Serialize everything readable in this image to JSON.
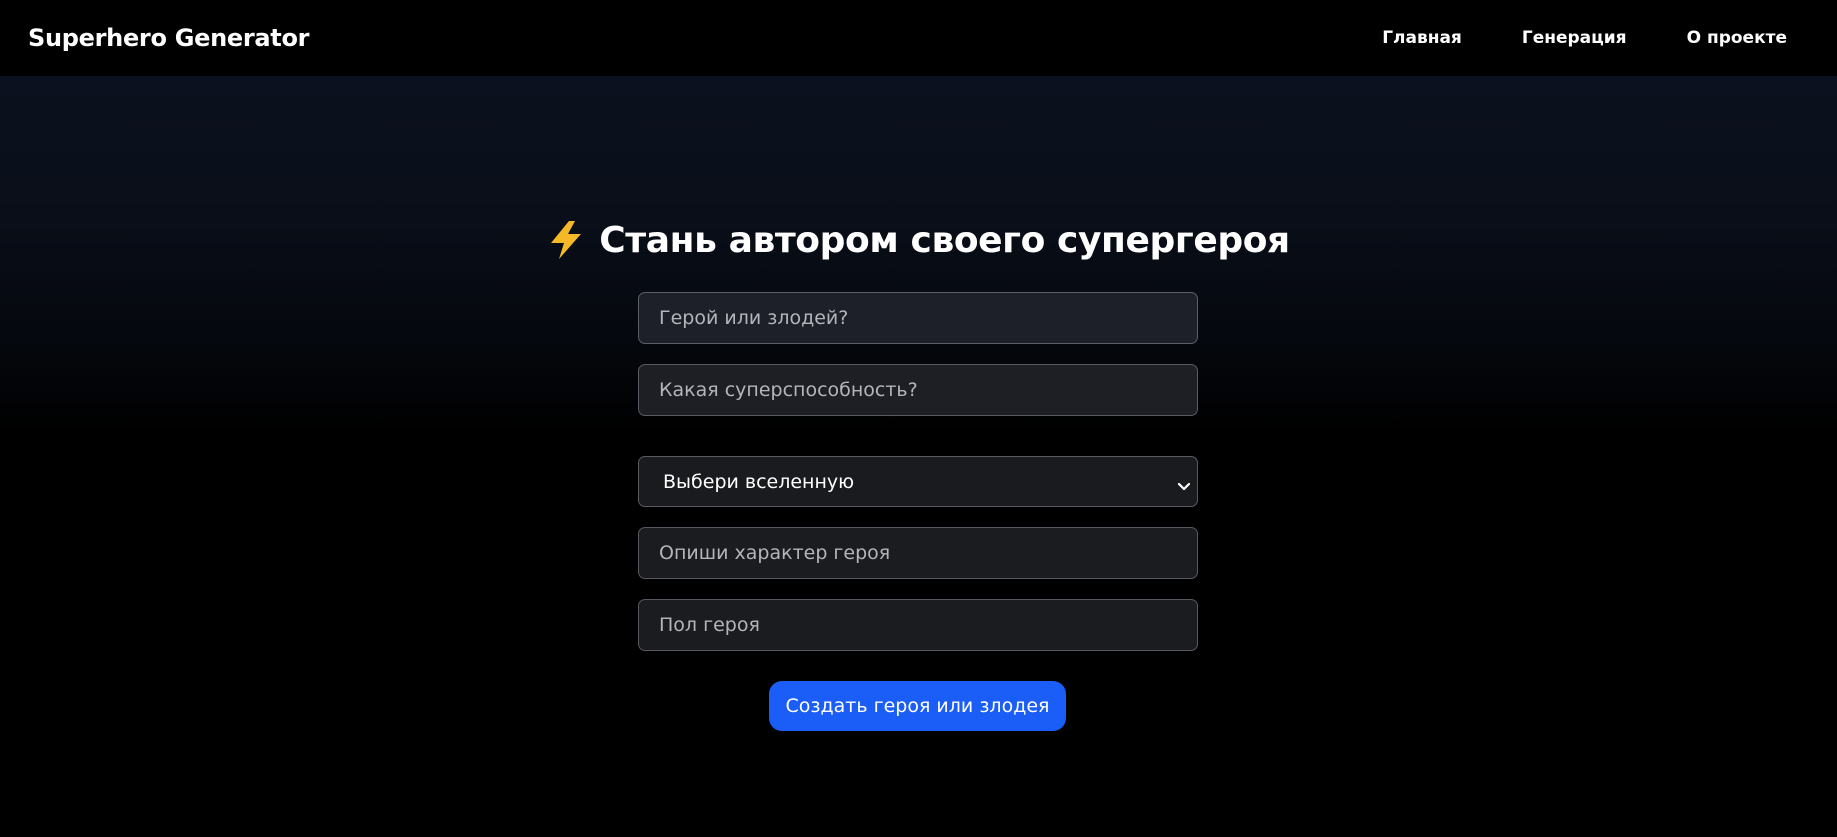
{
  "navbar": {
    "brand": "Superhero Generator",
    "links": [
      {
        "label": "Главная"
      },
      {
        "label": "Генерация"
      },
      {
        "label": "О проекте"
      }
    ]
  },
  "main": {
    "title_icon": "lightning-bolt-icon",
    "title": "Стань автором своего супергероя",
    "fields": {
      "role_placeholder": "Герой или злодей?",
      "power_placeholder": "Какая суперспособность?",
      "universe_selected": "Выбери вселенную",
      "character_placeholder": "Опиши характер героя",
      "gender_placeholder": "Пол героя"
    },
    "submit_label": "Создать героя или злодея"
  },
  "colors": {
    "navbar_bg": "#000000",
    "accent_button": "#1b5ef7",
    "bolt": "#f5b928"
  }
}
